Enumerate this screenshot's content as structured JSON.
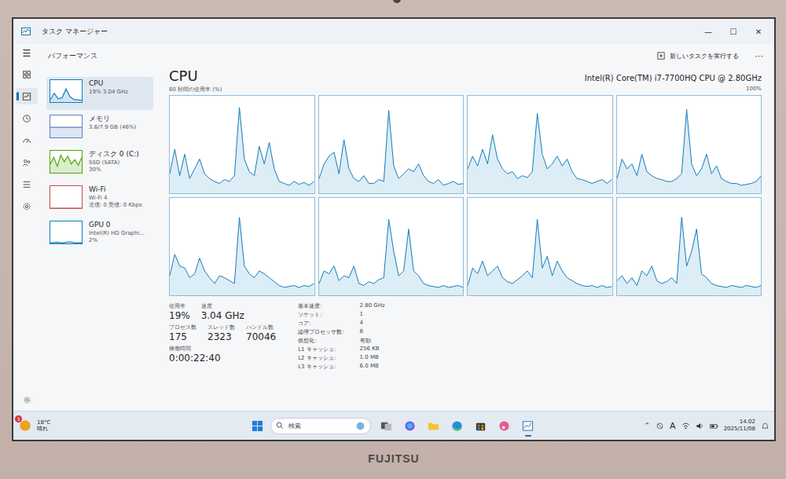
{
  "window": {
    "title": "タスク マネージャー",
    "controls": [
      "—",
      "☐",
      "✕"
    ]
  },
  "nav": {
    "menu": "☰",
    "items": [
      {
        "selected": false
      },
      {
        "selected": true
      },
      {
        "selected": false
      },
      {
        "selected": false
      },
      {
        "selected": false
      },
      {
        "selected": false
      },
      {
        "selected": false
      }
    ]
  },
  "page_title": "パフォーマンス",
  "toolbar": {
    "run_task": "新しいタスクを実行する",
    "more": "⋯"
  },
  "devices": [
    {
      "name": "CPU",
      "detail": [
        "19% 3.04 GHz"
      ],
      "selected": true,
      "color": "#117dbb",
      "values": [
        10,
        40,
        15,
        20,
        60,
        25,
        12,
        10,
        8
      ]
    },
    {
      "name": "メモリ",
      "detail": [
        "3.6/7.9 GB (46%)"
      ],
      "selected": false,
      "color": "#5b7fc4",
      "values": [
        46,
        46,
        46,
        46,
        46,
        46,
        46,
        46
      ]
    },
    {
      "name": "ディスク 0 (C:)",
      "detail": [
        "SSD (SATA)",
        "30%"
      ],
      "selected": false,
      "color": "#4da60c",
      "values": [
        40,
        70,
        30,
        80,
        50,
        75,
        40,
        60,
        35,
        70
      ]
    },
    {
      "name": "Wi-Fi",
      "detail": [
        "Wi-Fi 4",
        "送信: 0 受信: 0 Kbps"
      ],
      "selected": false,
      "color": "#c0504d",
      "values": [
        0,
        0,
        0,
        0,
        0
      ]
    },
    {
      "name": "GPU 0",
      "detail": [
        "Intel(R) HD Graphi...",
        "2%"
      ],
      "selected": false,
      "color": "#117dbb",
      "values": [
        2,
        5,
        2,
        8,
        2,
        2
      ]
    }
  ],
  "main": {
    "title": "CPU",
    "model": "Intel(R) Core(TM) i7-7700HQ CPU @ 2.80GHz",
    "graph_label": "60 秒間の使用率 (%)",
    "graph_max": "100%",
    "cores": [
      [
        20,
        45,
        18,
        40,
        15,
        25,
        35,
        20,
        15,
        12,
        10,
        14,
        12,
        18,
        88,
        35,
        22,
        18,
        48,
        30,
        52,
        25,
        12,
        10,
        8,
        12,
        9,
        11,
        8,
        12
      ],
      [
        15,
        30,
        38,
        42,
        20,
        55,
        25,
        15,
        12,
        18,
        10,
        10,
        14,
        12,
        85,
        28,
        15,
        20,
        25,
        22,
        30,
        18,
        12,
        10,
        14,
        8,
        10,
        12,
        9,
        10
      ],
      [
        25,
        38,
        28,
        45,
        30,
        60,
        35,
        25,
        20,
        22,
        15,
        18,
        16,
        22,
        82,
        40,
        25,
        30,
        38,
        28,
        35,
        22,
        15,
        14,
        12,
        10,
        12,
        14,
        10,
        14
      ],
      [
        15,
        35,
        25,
        30,
        18,
        40,
        22,
        18,
        15,
        14,
        12,
        12,
        15,
        20,
        86,
        30,
        18,
        25,
        40,
        20,
        28,
        15,
        12,
        10,
        10,
        8,
        9,
        10,
        12,
        18
      ],
      [
        20,
        42,
        30,
        28,
        18,
        22,
        38,
        25,
        18,
        12,
        20,
        18,
        15,
        12,
        80,
        30,
        22,
        18,
        25,
        22,
        18,
        14,
        10,
        8,
        9,
        10,
        8,
        10,
        9,
        12
      ],
      [
        12,
        25,
        22,
        30,
        15,
        20,
        18,
        30,
        12,
        10,
        14,
        12,
        16,
        18,
        78,
        45,
        20,
        25,
        68,
        25,
        20,
        12,
        10,
        9,
        8,
        10,
        8,
        9,
        10,
        8
      ],
      [
        10,
        28,
        22,
        35,
        20,
        25,
        30,
        18,
        14,
        12,
        16,
        20,
        25,
        18,
        78,
        28,
        40,
        20,
        35,
        25,
        18,
        15,
        12,
        10,
        9,
        10,
        8,
        10,
        8,
        9
      ],
      [
        15,
        20,
        12,
        18,
        10,
        25,
        20,
        30,
        15,
        12,
        14,
        18,
        12,
        80,
        30,
        45,
        68,
        22,
        18,
        12,
        10,
        9,
        8,
        10,
        9,
        8,
        10,
        9,
        8,
        10
      ]
    ],
    "stat_rows": [
      [
        {
          "label": "使用率",
          "value": "19%"
        },
        {
          "label": "速度",
          "value": "3.04 GHz"
        }
      ],
      [
        {
          "label": "プロセス数",
          "value": "175"
        },
        {
          "label": "スレッド数",
          "value": "2323"
        },
        {
          "label": "ハンドル数",
          "value": "70046"
        }
      ],
      [
        {
          "label": "稼働時間",
          "value": "0:00:22:40"
        }
      ]
    ],
    "details": [
      {
        "label": "基本速度:",
        "value": "2.80 GHz"
      },
      {
        "label": "ソケット:",
        "value": "1"
      },
      {
        "label": "コア:",
        "value": "4"
      },
      {
        "label": "論理プロセッサ数:",
        "value": "8"
      },
      {
        "label": "仮想化:",
        "value": "有効"
      },
      {
        "label": "L1 キャッシュ:",
        "value": "256 KB"
      },
      {
        "label": "L2 キャッシュ:",
        "value": "1.0 MB"
      },
      {
        "label": "L3 キャッシュ:",
        "value": "6.0 MB"
      }
    ]
  },
  "taskbar": {
    "weather": {
      "temp": "18°C",
      "condition": "晴れ",
      "badge": "3"
    },
    "search": "検索",
    "apps": [
      {
        "running": false
      },
      {
        "running": false
      },
      {
        "running": false
      },
      {
        "running": false
      },
      {
        "running": false
      },
      {
        "running": false
      },
      {
        "running": true
      }
    ],
    "tray": {
      "chevron": "⌃",
      "ime": "A",
      "time": "14:02",
      "date": "2025/11/08"
    }
  },
  "brand": "FUJITSU"
}
